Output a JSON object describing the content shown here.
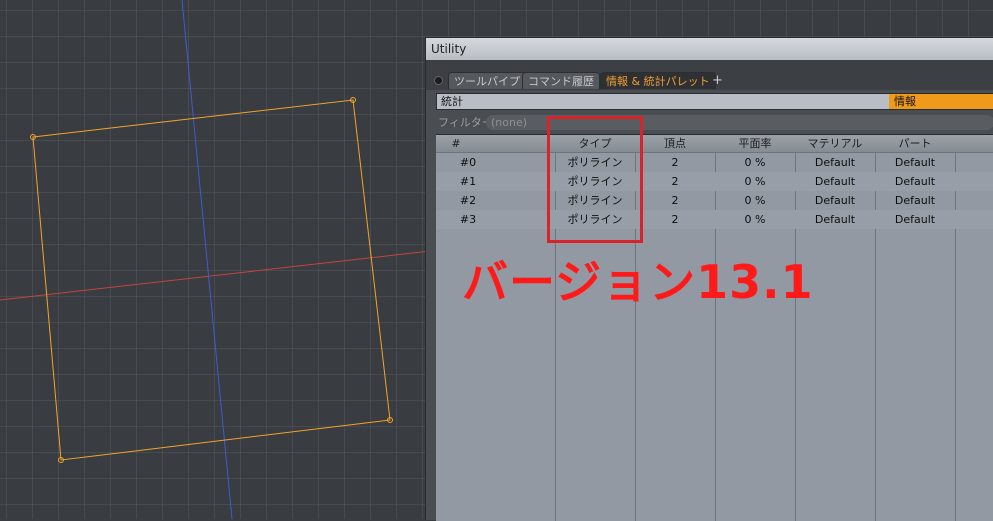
{
  "panel": {
    "title": "Utility",
    "tabs": [
      "ツールパイプ",
      "コマンド履歴",
      "情報 & 統計パレット"
    ],
    "active_tab_index": 2,
    "add_tab_label": "+",
    "stats_label": "統計",
    "info_label": "情報",
    "filter_label": "フィルター",
    "filter_placeholder": "(none)"
  },
  "table": {
    "columns": [
      "#",
      "タイプ",
      "頂点",
      "平面率",
      "マテリアル",
      "パート"
    ],
    "rows": [
      {
        "id": "#0",
        "type": "ポリライン",
        "vertices": "2",
        "planarity": "0 %",
        "material": "Default",
        "part": "Default"
      },
      {
        "id": "#1",
        "type": "ポリライン",
        "vertices": "2",
        "planarity": "0 %",
        "material": "Default",
        "part": "Default"
      },
      {
        "id": "#2",
        "type": "ポリライン",
        "vertices": "2",
        "planarity": "0 %",
        "material": "Default",
        "part": "Default"
      },
      {
        "id": "#3",
        "type": "ポリライン",
        "vertices": "2",
        "planarity": "0 %",
        "material": "Default",
        "part": "Default"
      }
    ]
  },
  "annotation": {
    "version_text": "バージョン13.1",
    "color": "#ff1a1a"
  },
  "colors": {
    "accent": "#f09a1c",
    "polyline": "#f2a52a",
    "axis_x": "#c0463c",
    "axis_y": "#3f5ad8"
  }
}
